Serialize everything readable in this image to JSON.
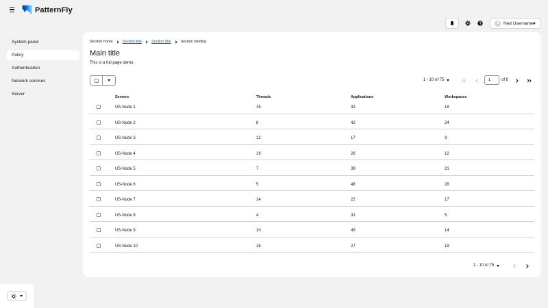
{
  "header": {
    "logo_text": "PatternFly",
    "user_name": "Ned Username"
  },
  "sidebar": {
    "items": [
      {
        "label": "System panel",
        "active": false
      },
      {
        "label": "Policy",
        "active": true
      },
      {
        "label": "Authentication",
        "active": false
      },
      {
        "label": "Network services",
        "active": false
      },
      {
        "label": "Server",
        "active": false
      }
    ]
  },
  "breadcrumb": [
    {
      "label": "Section home",
      "link": false
    },
    {
      "label": "Section title",
      "link": true
    },
    {
      "label": "Section title",
      "link": true
    },
    {
      "label": "Section landing",
      "link": false
    }
  ],
  "page": {
    "title": "Main title",
    "description": "This is a full page demo."
  },
  "pagination": {
    "range_label": "1 - 10 of 75",
    "current_page": "1",
    "of_pages": "of 8"
  },
  "table": {
    "columns": [
      "Servers",
      "Threads",
      "Applications",
      "Workspaces"
    ],
    "rows": [
      [
        "US-Node 1",
        "15",
        "32",
        "18"
      ],
      [
        "US-Node 2",
        "8",
        "42",
        "24"
      ],
      [
        "US-Node 3",
        "12",
        "17",
        "9"
      ],
      [
        "US-Node 4",
        "19",
        "26",
        "12"
      ],
      [
        "US-Node 5",
        "7",
        "39",
        "21"
      ],
      [
        "US-Node 6",
        "5",
        "48",
        "28"
      ],
      [
        "US-Node 7",
        "14",
        "22",
        "17"
      ],
      [
        "US-Node 8",
        "4",
        "31",
        "5"
      ],
      [
        "US-Node 9",
        "10",
        "45",
        "14"
      ],
      [
        "US-Node 10",
        "16",
        "27",
        "19"
      ]
    ]
  },
  "icons": {
    "menu": "hamburger-icon",
    "notifications": "bell-icon",
    "settings": "gear-icon",
    "help": "question-circle-icon",
    "theme": "sun-icon"
  },
  "colors": {
    "link": "#0066cc",
    "logo_blue": "#0066cc",
    "logo_light": "#73bcf7",
    "background": "#f2f2f2"
  }
}
